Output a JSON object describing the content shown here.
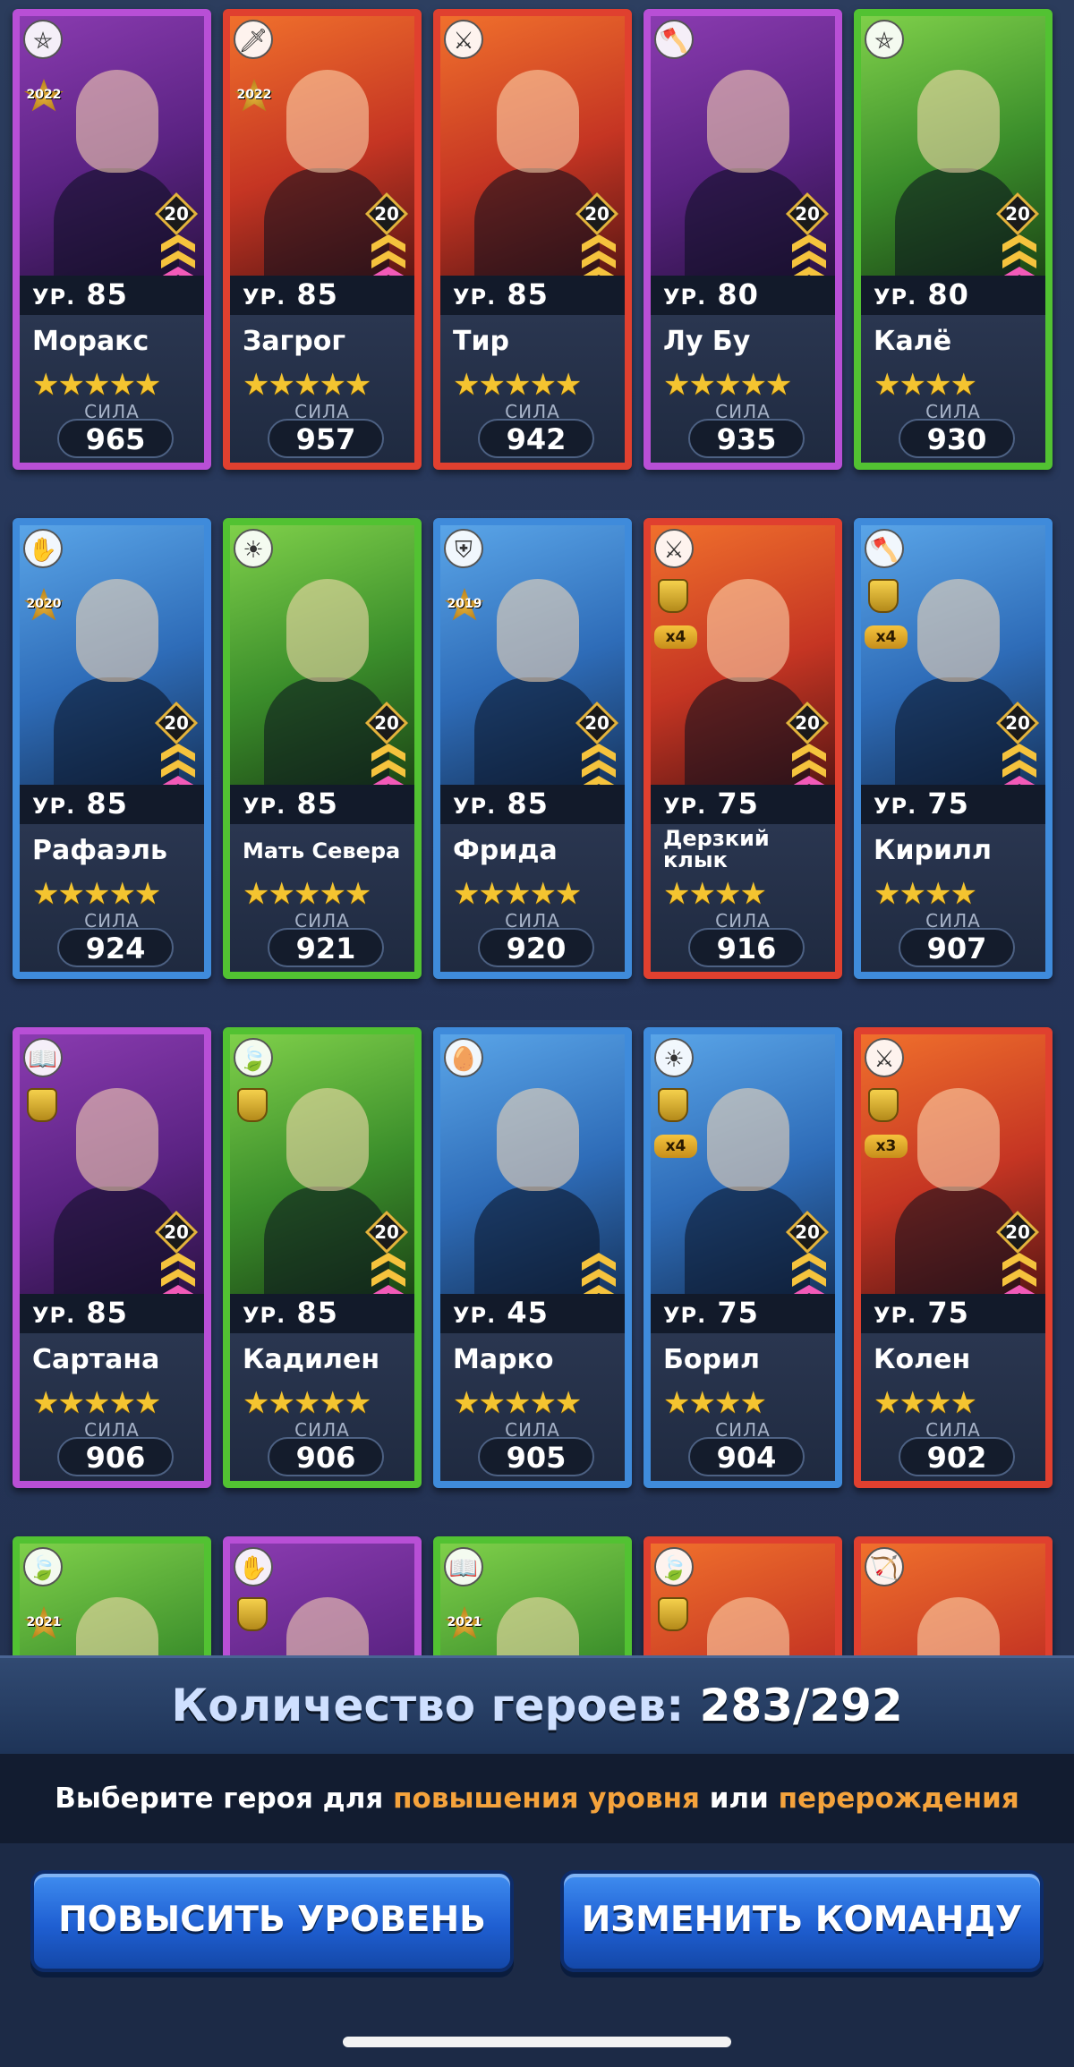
{
  "heroes": [
    {
      "name": "Моракс",
      "level_prefix": "УР.",
      "level": "85",
      "stars": "★★★★★",
      "power_label": "СИЛА",
      "power": "965",
      "rank": "20",
      "frame": "purple",
      "class_icon": "pentagram-icon",
      "badge": "2022",
      "chevron_color": "#f25ab8"
    },
    {
      "name": "Загрог",
      "level_prefix": "УР.",
      "level": "85",
      "stars": "★★★★★",
      "power_label": "СИЛА",
      "power": "957",
      "rank": "20",
      "frame": "red",
      "class_icon": "dagger-icon",
      "badge": "2022",
      "chevron_color": "#f25ab8"
    },
    {
      "name": "Тир",
      "level_prefix": "УР.",
      "level": "85",
      "stars": "★★★★★",
      "power_label": "СИЛА",
      "power": "942",
      "rank": "20",
      "frame": "red",
      "class_icon": "crossed-swords-icon",
      "chevron_color": "#f5c33d"
    },
    {
      "name": "Лу Бу",
      "level_prefix": "УР.",
      "level": "80",
      "stars": "★★★★★",
      "power_label": "СИЛА",
      "power": "935",
      "rank": "20",
      "frame": "purple",
      "class_icon": "axe-icon",
      "chevron_color": "#f5c33d"
    },
    {
      "name": "Калё",
      "level_prefix": "УР.",
      "level": "80",
      "stars": "★★★★",
      "power_label": "СИЛА",
      "power": "930",
      "rank": "20",
      "frame": "green",
      "class_icon": "pentagram-icon",
      "chevron_color": "#f25ab8"
    },
    {
      "name": "Рафаэль",
      "level_prefix": "УР.",
      "level": "85",
      "stars": "★★★★★",
      "power_label": "СИЛА",
      "power": "924",
      "rank": "20",
      "frame": "blue",
      "class_icon": "hand-icon",
      "badge": "2020",
      "chevron_color": "#f25ab8"
    },
    {
      "name": "Мать Севера",
      "level_prefix": "УР.",
      "level": "85",
      "stars": "★★★★★",
      "power_label": "СИЛА",
      "power": "921",
      "rank": "20",
      "frame": "green",
      "class_icon": "sun-icon",
      "chevron_color": "#f25ab8"
    },
    {
      "name": "Фрида",
      "level_prefix": "УР.",
      "level": "85",
      "stars": "★★★★★",
      "power_label": "СИЛА",
      "power": "920",
      "rank": "20",
      "frame": "blue",
      "class_icon": "shield-icon",
      "badge": "2019",
      "chevron_color": "#f5c33d"
    },
    {
      "name": "Дерзкий клык",
      "level_prefix": "УР.",
      "level": "75",
      "stars": "★★★★",
      "power_label": "СИЛА",
      "power": "916",
      "rank": "20",
      "frame": "red",
      "class_icon": "crossed-swords-icon",
      "multiplier": "x4",
      "chevron_color": "#f25ab8"
    },
    {
      "name": "Кирилл",
      "level_prefix": "УР.",
      "level": "75",
      "stars": "★★★★",
      "power_label": "СИЛА",
      "power": "907",
      "rank": "20",
      "frame": "blue",
      "class_icon": "axe-icon",
      "multiplier": "x4",
      "chevron_color": "#f25ab8"
    },
    {
      "name": "Сартана",
      "level_prefix": "УР.",
      "level": "85",
      "stars": "★★★★★",
      "power_label": "СИЛА",
      "power": "906",
      "rank": "20",
      "frame": "purple",
      "class_icon": "book-icon",
      "trophy": true,
      "chevron_color": "#f25ab8"
    },
    {
      "name": "Кадилен",
      "level_prefix": "УР.",
      "level": "85",
      "stars": "★★★★★",
      "power_label": "СИЛА",
      "power": "906",
      "rank": "20",
      "frame": "green",
      "class_icon": "leaf-icon",
      "trophy": true,
      "chevron_color": "#f25ab8"
    },
    {
      "name": "Марко",
      "level_prefix": "УР.",
      "level": "45",
      "stars": "★★★★★",
      "power_label": "СИЛА",
      "power": "905",
      "rank": "",
      "frame": "blue",
      "class_icon": "egg-icon",
      "chevron_color": "#f5c33d"
    },
    {
      "name": "Борил",
      "level_prefix": "УР.",
      "level": "75",
      "stars": "★★★★",
      "power_label": "СИЛА",
      "power": "904",
      "rank": "20",
      "frame": "blue",
      "class_icon": "sun-icon",
      "multiplier": "x4",
      "chevron_color": "#f25ab8"
    },
    {
      "name": "Колен",
      "level_prefix": "УР.",
      "level": "75",
      "stars": "★★★★",
      "power_label": "СИЛА",
      "power": "902",
      "rank": "20",
      "frame": "red",
      "class_icon": "crossed-swords-icon",
      "multiplier": "x3",
      "chevron_color": "#f25ab8"
    },
    {
      "frame": "green",
      "class_icon": "leaf-icon",
      "badge": "2021"
    },
    {
      "frame": "purple",
      "class_icon": "hand-icon",
      "trophy": true
    },
    {
      "frame": "green",
      "class_icon": "book-icon",
      "badge": "2021"
    },
    {
      "frame": "red",
      "class_icon": "leaf-icon",
      "trophy": true
    },
    {
      "frame": "red",
      "class_icon": "bow-icon"
    }
  ],
  "footer": {
    "count_label": "Количество героев:",
    "count_value": "283/292",
    "hint_part1": "Выберите героя для ",
    "hint_link1": "повышения уровня",
    "hint_mid": " или ",
    "hint_link2": "перерождения",
    "btn_level_up": "ПОВЫСИТЬ УРОВЕНЬ",
    "btn_change_team": "ИЗМЕНИТЬ КОМАНДУ"
  }
}
